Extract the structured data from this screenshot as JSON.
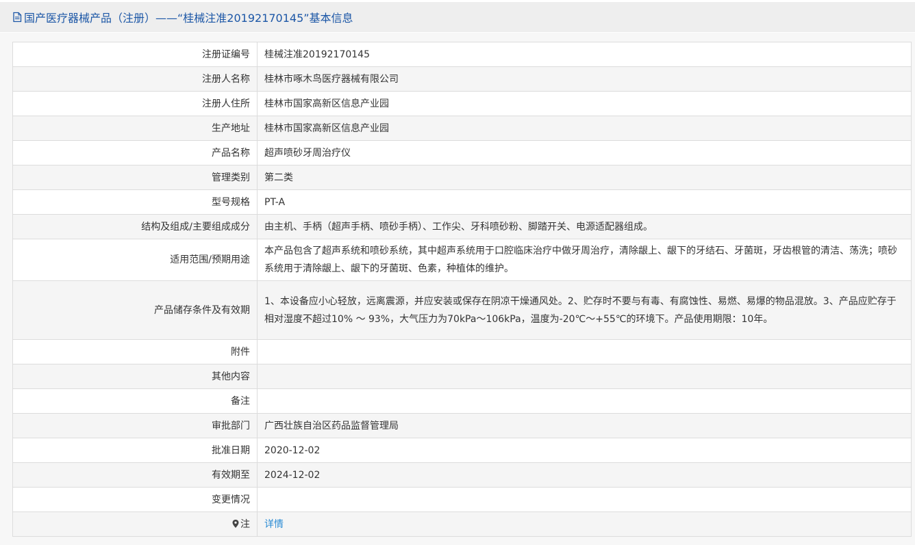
{
  "header": {
    "title": "国产医疗器械产品（注册）——“桂械注准20192170145”基本信息",
    "icon": "document-icon",
    "color": "#1b56a6"
  },
  "rows": [
    {
      "label": "注册证编号",
      "value": "桂械注准20192170145"
    },
    {
      "label": "注册人名称",
      "value": "桂林市啄木鸟医疗器械有限公司"
    },
    {
      "label": "注册人住所",
      "value": "桂林市国家高新区信息产业园"
    },
    {
      "label": "生产地址",
      "value": "桂林市国家高新区信息产业园"
    },
    {
      "label": "产品名称",
      "value": "超声喷砂牙周治疗仪"
    },
    {
      "label": "管理类别",
      "value": "第二类"
    },
    {
      "label": "型号规格",
      "value": "PT-A"
    },
    {
      "label": "结构及组成/主要组成成分",
      "value": "由主机、手柄（超声手柄、喷砂手柄）、工作尖、牙科喷砂粉、脚踏开关、电源适配器组成。"
    },
    {
      "label": "适用范围/预期用途",
      "value": "本产品包含了超声系统和喷砂系统，其中超声系统用于口腔临床治疗中做牙周治疗，清除龈上、龈下的牙结石、牙菌斑，牙齿根管的清洁、荡洗；喷砂系统用于清除龈上、龈下的牙菌斑、色素，种植体的维护。"
    },
    {
      "label": "产品储存条件及有效期",
      "value": "1、本设备应小心轻放，远离震源，并应安装或保存在阴凉干燥通风处。2、贮存时不要与有毒、有腐蚀性、易燃、易爆的物品混放。3、产品应贮存于相对湿度不超过10% ～ 93%，大气压力为70kPa～106kPa，温度为-20℃～+55℃的环境下。产品使用期限：10年。"
    },
    {
      "label": "附件",
      "value": ""
    },
    {
      "label": "其他内容",
      "value": ""
    },
    {
      "label": "备注",
      "value": ""
    },
    {
      "label": "审批部门",
      "value": "广西壮族自治区药品监督管理局"
    },
    {
      "label": "批准日期",
      "value": "2020-12-02"
    },
    {
      "label": "有效期至",
      "value": "2024-12-02"
    },
    {
      "label": "变更情况",
      "value": ""
    }
  ],
  "note_row": {
    "icon": "pin-icon",
    "label": "注",
    "link_text": "详情",
    "link_color": "#2a8bd4"
  }
}
